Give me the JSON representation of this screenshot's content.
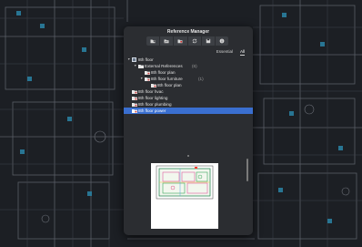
{
  "window": {
    "title": "Reference Manager"
  },
  "toolbar": {
    "buttons": [
      {
        "icon": "attach-dwg-icon"
      },
      {
        "icon": "attach-image-icon"
      },
      {
        "icon": "attach-pdf-icon"
      },
      {
        "icon": "refresh-icon"
      },
      {
        "icon": "save-icon"
      },
      {
        "icon": "info-icon"
      }
    ]
  },
  "filters": {
    "essential_label": "Essential",
    "all_label": "All",
    "active": "All"
  },
  "tree": {
    "root": {
      "label": "8th floor"
    },
    "external_references": {
      "label": "External References",
      "count": "(6)"
    },
    "items": [
      {
        "label": "8th floor plan"
      },
      {
        "label": "8th floor furniture",
        "count": "(1)"
      },
      {
        "label": "8th floor plan"
      },
      {
        "label": "8th floor hvac"
      },
      {
        "label": "8th floor lighting"
      },
      {
        "label": "8th floor plumbing"
      },
      {
        "label": "8th floor power",
        "selected": true
      }
    ]
  },
  "colors": {
    "selection": "#3a6fd0",
    "panel": "#2b2d31",
    "canvas": "#1c1f24"
  }
}
